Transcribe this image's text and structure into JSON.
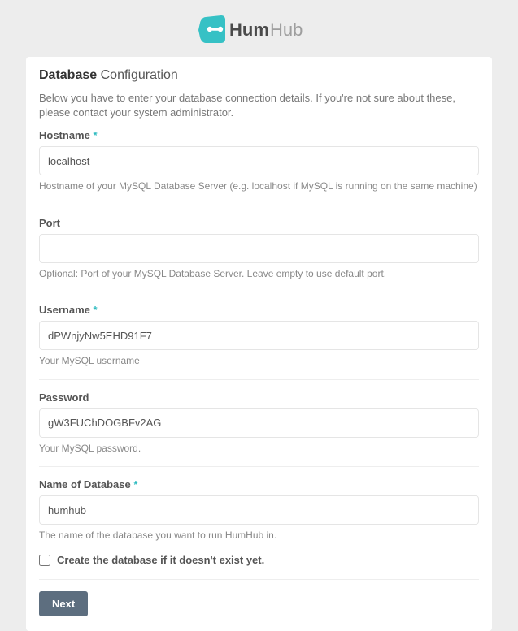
{
  "brand": {
    "name": "HumHub"
  },
  "title": {
    "strong": "Database",
    "light": "Configuration"
  },
  "intro": "Below you have to enter your database connection details. If you're not sure about these, please contact your system administrator.",
  "fields": {
    "hostname": {
      "label": "Hostname",
      "required": "*",
      "value": "localhost",
      "hint": "Hostname of your MySQL Database Server (e.g. localhost if MySQL is running on the same machine)"
    },
    "port": {
      "label": "Port",
      "value": "",
      "hint": "Optional: Port of your MySQL Database Server. Leave empty to use default port."
    },
    "username": {
      "label": "Username",
      "required": "*",
      "value": "dPWnjyNw5EHD91F7",
      "hint": "Your MySQL username"
    },
    "password": {
      "label": "Password",
      "value": "gW3FUChDOGBFv2AG",
      "hint": "Your MySQL password."
    },
    "database": {
      "label": "Name of Database",
      "required": "*",
      "value": "humhub",
      "hint": "The name of the database you want to run HumHub in."
    },
    "create": {
      "label": "Create the database if it doesn't exist yet."
    }
  },
  "buttons": {
    "next": "Next"
  }
}
